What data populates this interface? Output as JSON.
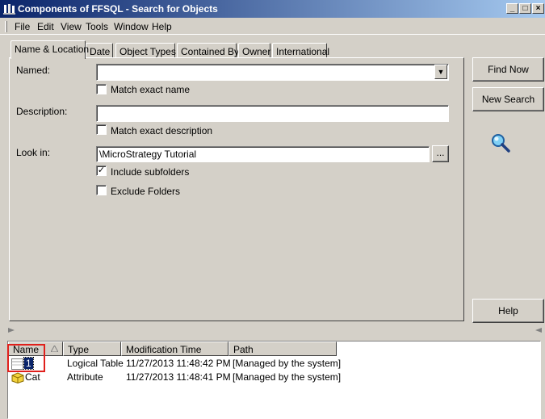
{
  "window": {
    "title": "Components of FFSQL - Search for Objects",
    "controls": {
      "minimize": "_",
      "maximize": "□",
      "close": "×"
    }
  },
  "menu": [
    "File",
    "Edit",
    "View",
    "Tools",
    "Window",
    "Help"
  ],
  "tabs": [
    "Name & Location",
    "Date",
    "Object Types",
    "Contained By",
    "Owner",
    "International"
  ],
  "form": {
    "named_label": "Named:",
    "named_value": "",
    "match_exact_name": "Match exact name",
    "description_label": "Description:",
    "description_value": "",
    "match_exact_description": "Match exact description",
    "lookin_label": "Look in:",
    "lookin_value": "\\MicroStrategy Tutorial",
    "browse": "...",
    "include_subfolders": "Include subfolders",
    "include_subfolders_checked": true,
    "exclude_folders": "Exclude Folders",
    "exclude_folders_checked": false
  },
  "buttons": {
    "find_now": "Find Now",
    "new_search": "New Search",
    "help": "Help"
  },
  "icons": {
    "search": "magnifier-icon",
    "sort": "sort-ascending-icon"
  },
  "results": {
    "columns": [
      "Name",
      "Type",
      "Modification Time",
      "Path"
    ],
    "rows": [
      {
        "name": "1",
        "type": "Logical Table",
        "modified": "11/27/2013 11:48:42 PM",
        "path": "[Managed by the system]"
      },
      {
        "name": "Cat",
        "type": "Attribute",
        "modified": "11/27/2013 11:48:41 PM",
        "path": "[Managed by the system]"
      }
    ]
  },
  "colors": {
    "highlight": "#e0201c",
    "titlebar_start": "#0a246a",
    "titlebar_end": "#a6caf0"
  }
}
